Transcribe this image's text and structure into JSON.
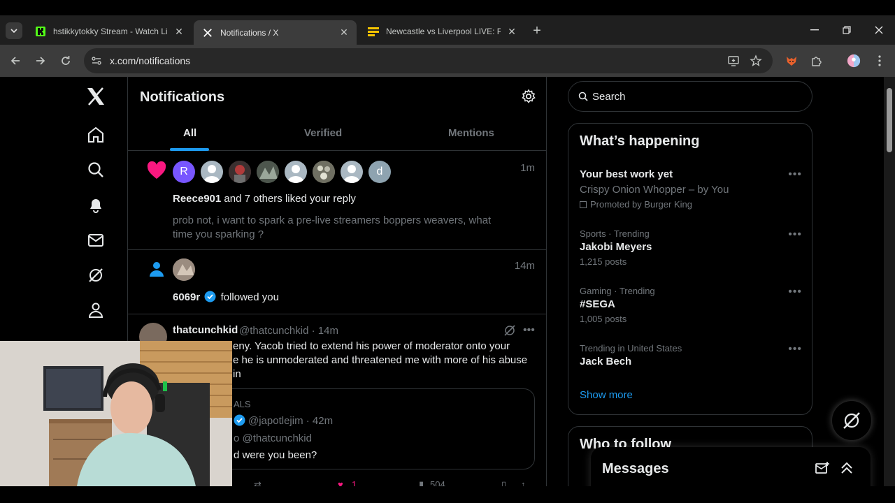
{
  "browser": {
    "tabs": [
      {
        "title": "hstikkytokky Stream - Watch Li",
        "active": false
      },
      {
        "title": "Notifications / X",
        "active": true
      },
      {
        "title": "Newcastle vs Liverpool LIVE: Pre",
        "active": false
      }
    ],
    "url": "x.com/notifications"
  },
  "leftnav": {
    "items": [
      "x-logo-icon",
      "home-icon",
      "explore-icon",
      "notifications-icon",
      "messages-icon",
      "grok-icon",
      "profile-icon"
    ]
  },
  "main": {
    "title": "Notifications",
    "tabs": [
      "All",
      "Verified",
      "Mentions"
    ],
    "notifications": [
      {
        "type": "like",
        "time": "1m",
        "avatars": [
          "R",
          "",
          "",
          "",
          "",
          "",
          "",
          "d"
        ],
        "actor": "Reece901",
        "text": " and 7 others liked your reply",
        "sub": "prob not, i want to spark a pre-live streamers boppers weavers, what time you sparking ?"
      },
      {
        "type": "follow",
        "time": "14m",
        "actor": "6069r",
        "text": "followed you"
      }
    ],
    "tweet": {
      "name": "thatcunchkid",
      "handle": "@thatcunchkid · 14m",
      "body_line1": "eny. Yacob tried to extend his power of moderator onto your",
      "body_line2": "e he is unmoderated and threatened me with more of his abuse in",
      "quote": {
        "tag": "ALS",
        "handle": "@japotlejim · 42m",
        "reply": "o @thatcunchkid",
        "text": "d were you been?"
      },
      "actions": {
        "likes": "1",
        "views": "504"
      }
    }
  },
  "right": {
    "search_placeholder": "Search",
    "happening": {
      "title": "What’s happening",
      "trends": [
        {
          "meta": "",
          "name": "Your best work yet",
          "sub": "Crispy Onion Whopper – by You",
          "count": "Promoted by Burger King"
        },
        {
          "meta": "Sports · Trending",
          "name": "Jakobi Meyers",
          "count": "1,215 posts"
        },
        {
          "meta": "Gaming · Trending",
          "name": "#SEGA",
          "count": "1,005 posts"
        },
        {
          "meta": "Trending in United States",
          "name": "Jack Bech",
          "count": ""
        }
      ],
      "show_more": "Show more"
    },
    "who_to_follow": {
      "title": "Who to follow"
    },
    "messages": {
      "title": "Messages"
    }
  }
}
